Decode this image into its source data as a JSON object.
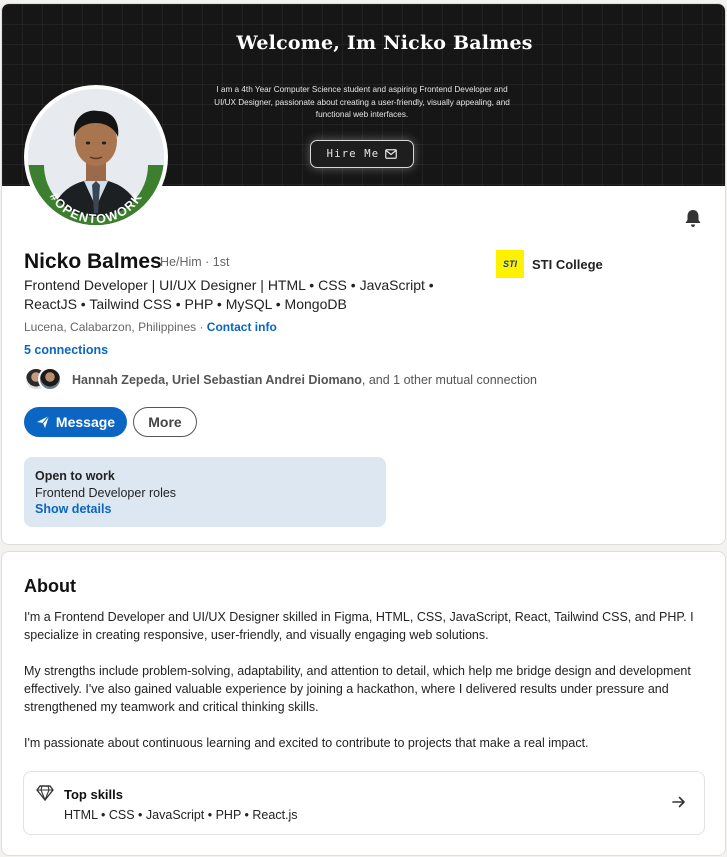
{
  "banner": {
    "title": "Welcome, Im Nicko Balmes",
    "subtitle": "I am a 4th Year Computer Science student and aspiring Frontend Developer and UI/UX Designer, passionate about creating a user-friendly, visually appealing, and functional web interfaces.",
    "hire_label": "Hire Me"
  },
  "profile": {
    "open_to_work_badge": "#OPENTOWORK",
    "name": "Nicko Balmes",
    "pronouns": "He/Him · 1st",
    "headline": "Frontend Developer | UI/UX Designer | HTML • CSS • JavaScript • ReactJS • Tailwind CSS • PHP • MySQL • MongoDB",
    "location": "Lucena, Calabarzon, Philippines · ",
    "contact_info": "Contact info",
    "connections": "5 connections",
    "mutual": {
      "names": "Hannah Zepeda, Uriel Sebastian Andrei Diomano",
      "suffix": ", and 1 other mutual connection"
    },
    "message_label": "Message",
    "more_label": "More",
    "school": {
      "logo_text": "STI",
      "name": "STI College"
    },
    "open_to_work": {
      "title": "Open to work",
      "roles": "Frontend Developer roles",
      "link": "Show details"
    }
  },
  "about": {
    "title": "About",
    "paragraphs": [
      "I'm a Frontend Developer and UI/UX Designer skilled in Figma, HTML, CSS, JavaScript, React, Tailwind CSS, and PHP. I specialize in creating responsive, user-friendly, and visually engaging web solutions.",
      "My strengths include problem-solving, adaptability, and attention to detail, which help me bridge design and development effectively. I've also gained valuable experience by joining a hackathon, where I delivered results under pressure and strengthened my teamwork and critical thinking skills.",
      "I'm passionate about continuous learning and excited to contribute to projects that make a real impact."
    ],
    "top_skills": {
      "title": "Top skills",
      "list": "HTML • CSS • JavaScript • PHP • React.js"
    }
  },
  "colors": {
    "accent": "#0a66c2",
    "open_to_work_green": "#3a7d2c",
    "open_to_work_box": "#dde7f1",
    "banner_bg": "#161616"
  },
  "icons": [
    "mail-icon",
    "bell-icon",
    "send-icon",
    "diamond-icon",
    "arrow-right-icon"
  ]
}
